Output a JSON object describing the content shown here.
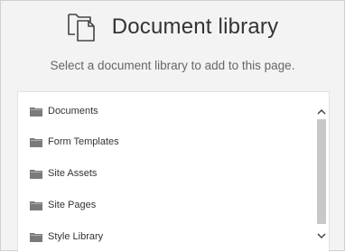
{
  "header": {
    "icon": "document-library-icon",
    "title": "Document library"
  },
  "subtitle": "Select a document library to add to this page.",
  "libraries": [
    {
      "label": "Documents",
      "icon": "folder-icon"
    },
    {
      "label": "Form Templates",
      "icon": "folder-icon"
    },
    {
      "label": "Site Assets",
      "icon": "folder-icon"
    },
    {
      "label": "Site Pages",
      "icon": "folder-icon"
    },
    {
      "label": "Style Library",
      "icon": "folder-icon"
    }
  ],
  "scrollbar": {
    "up_icon": "chevron-up-icon",
    "down_icon": "chevron-down-icon"
  },
  "colors": {
    "panel_background": "#f3f3f3",
    "list_background": "#ffffff",
    "text": "#333333",
    "subtle_text": "#666666",
    "folder": "#7a7a7a",
    "scroll_thumb": "#c8c8c8"
  }
}
